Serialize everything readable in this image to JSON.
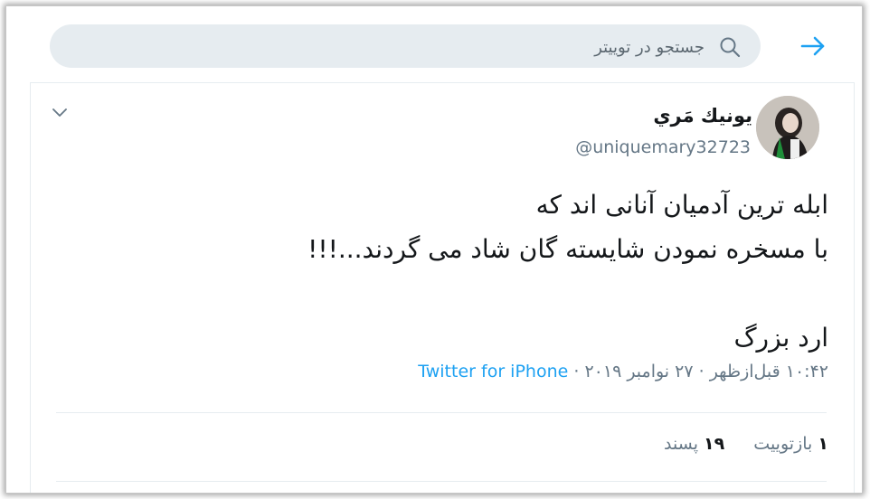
{
  "search": {
    "placeholder": "جستجو در توییتر"
  },
  "tweet": {
    "display_name": "يونيك مَري",
    "handle": "@uniquemary32723",
    "text_lines": [
      "ابله ترین آدمیان آنانی اند که",
      "با مسخره نمودن شایسته گان شاد می گردند...!!!",
      "",
      "ارد بزرگ"
    ],
    "time": "۱۰:۴۲ قبل‌ازظهر",
    "date": "۲۷ نوامبر ۲۰۱۹",
    "source": "Twitter for iPhone",
    "separator": "·",
    "retweets_count": "۱",
    "retweets_label": "بازتوییت",
    "likes_count": "۱۹",
    "likes_label": "پسند"
  },
  "colors": {
    "accent": "#1da1f2",
    "search_bg": "#e6ecf0",
    "muted": "#657786"
  },
  "icons": {
    "back": "arrow-right-icon",
    "search": "search-icon",
    "menu": "chevron-down-icon"
  }
}
